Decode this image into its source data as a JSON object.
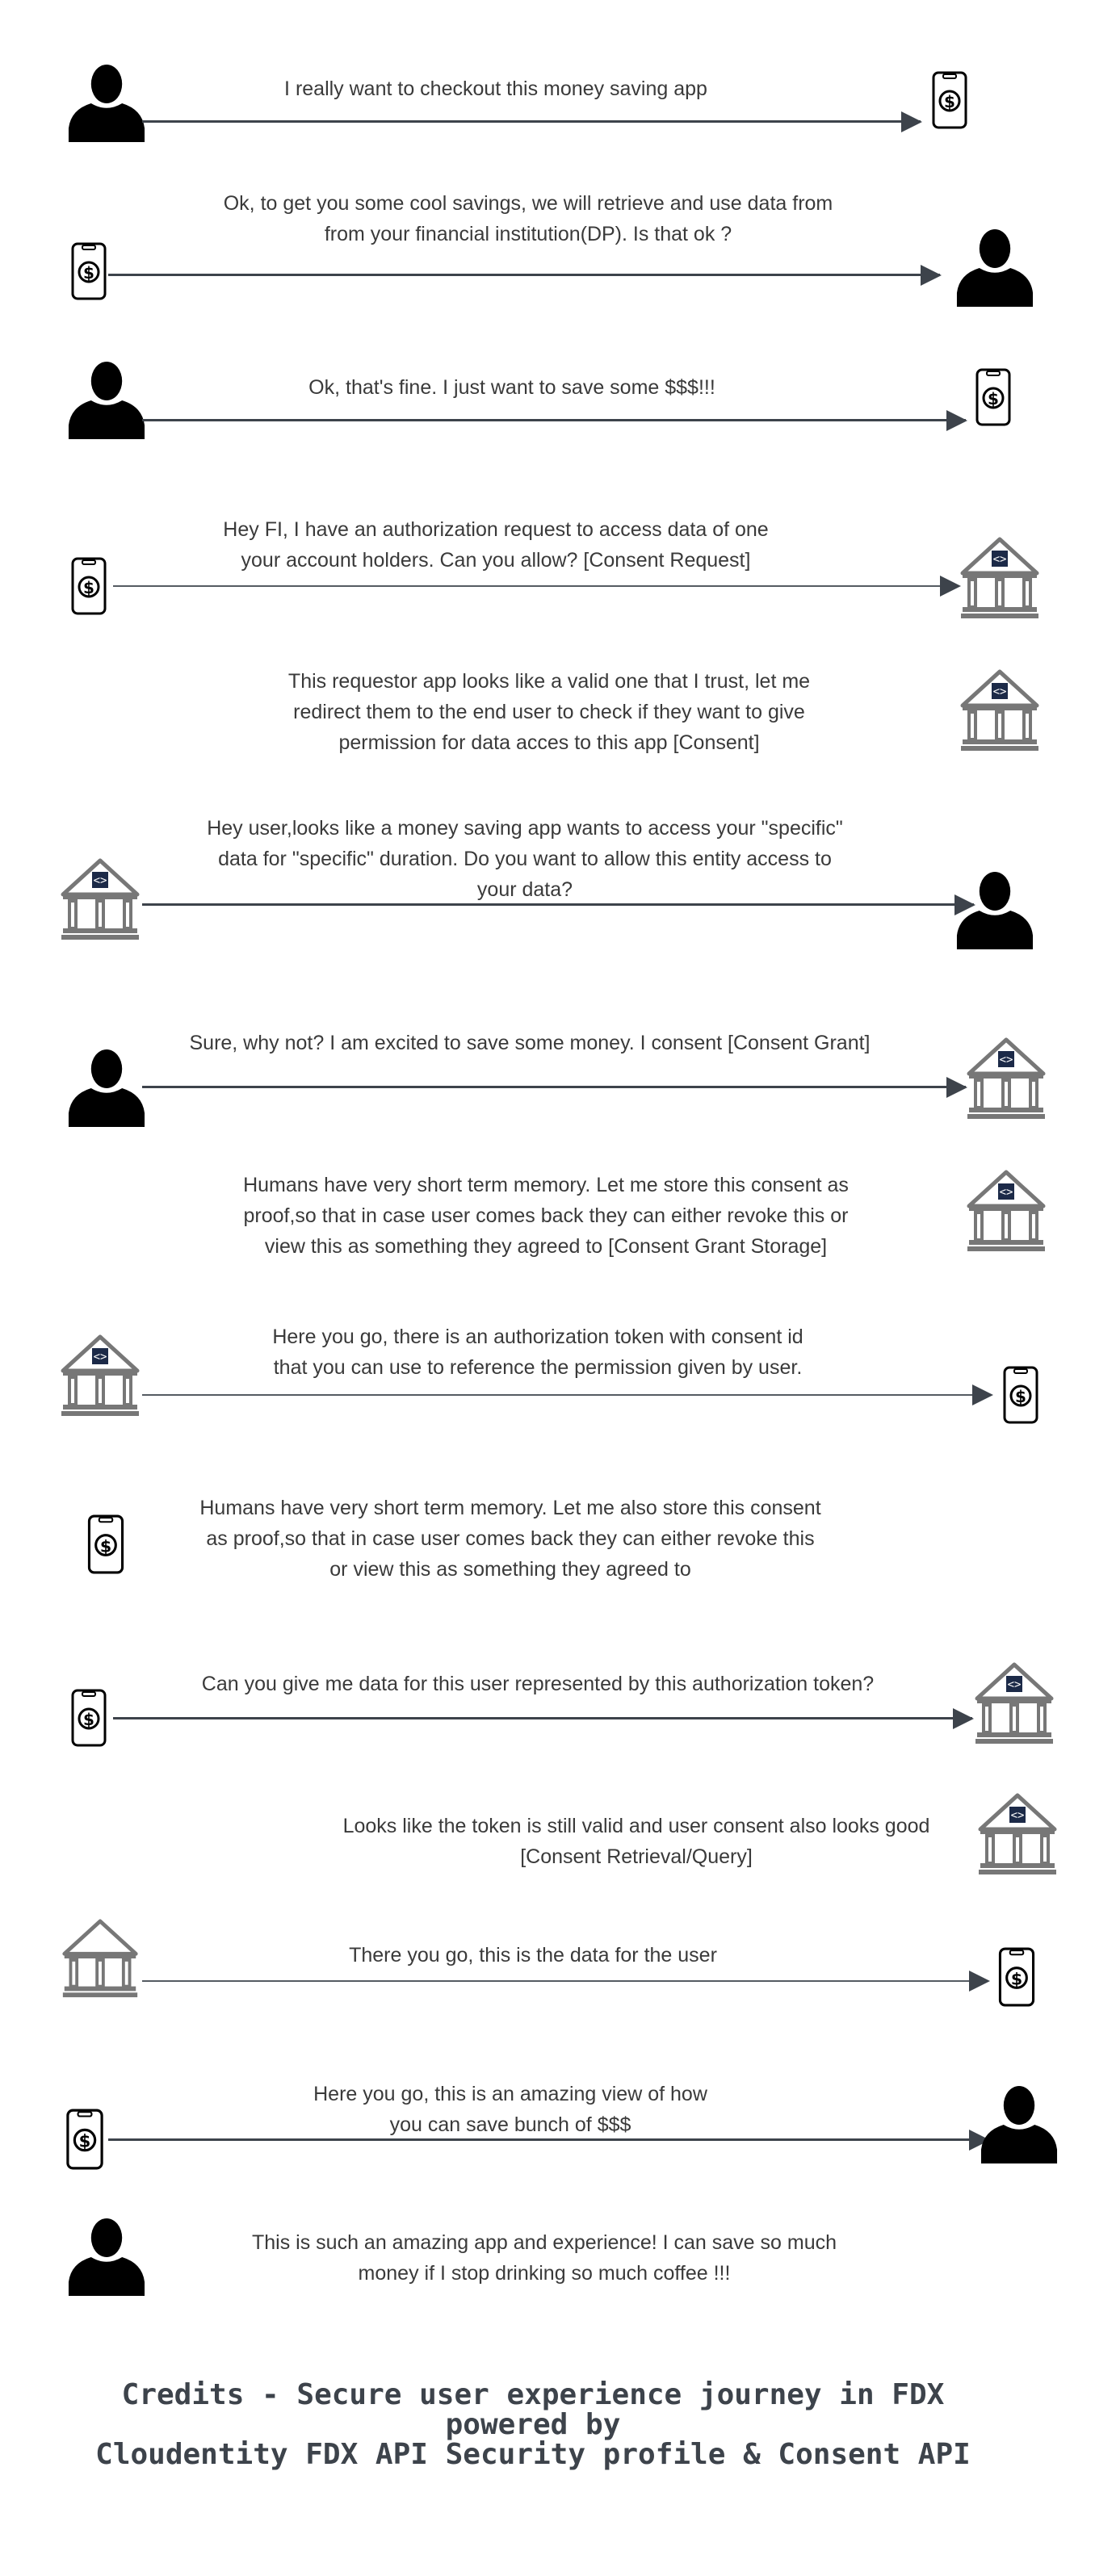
{
  "colors": {
    "arrow": "#3d434b",
    "text": "#3a3a3a",
    "bank": "#777777",
    "bank_logo": "#1c2a48",
    "user": "#000000"
  },
  "steps": [
    {
      "from": "user",
      "to": "app",
      "lines": [
        "I really want to checkout this money saving app"
      ]
    },
    {
      "from": "app",
      "to": "user",
      "lines": [
        "Ok, to get you some cool savings, we will retrieve and use data from",
        "from your financial institution(DP). Is that ok ?"
      ]
    },
    {
      "from": "user",
      "to": "app",
      "lines": [
        "Ok, that's fine. I just want to save some $$$!!!"
      ]
    },
    {
      "from": "app",
      "to": "bank",
      "lines": [
        "Hey FI, I have an authorization request to access data of one",
        "your account holders. Can you allow? [Consent Request]"
      ]
    },
    {
      "actor": "bank",
      "lines": [
        "This requestor app looks like a valid one that I trust, let me",
        "redirect them to the end user to check if they want to give",
        "permission for data acces to this app [Consent]"
      ]
    },
    {
      "from": "bank",
      "to": "user",
      "lines": [
        "Hey user,looks like a money saving app wants to access your \"specific\"",
        "data for \"specific\" duration. Do you want to allow this entity access to",
        "your data?"
      ]
    },
    {
      "from": "user",
      "to": "bank",
      "lines": [
        "Sure, why not? I am excited to save some money. I consent [Consent Grant]"
      ]
    },
    {
      "actor": "bank",
      "lines": [
        "Humans have very short term memory. Let me store this consent as",
        "proof,so that in case user comes back they can either revoke this or",
        "view this as something they agreed to [Consent Grant Storage]"
      ]
    },
    {
      "from": "bank",
      "to": "app",
      "lines": [
        "Here you go, there is an authorization token with consent id",
        "that you can use to reference the permission given by user."
      ]
    },
    {
      "actor": "app",
      "lines": [
        "Humans have very short term memory. Let me also store this consent",
        "as proof,so that in case user comes back they can either revoke this",
        "or view this as something they agreed to"
      ]
    },
    {
      "from": "app",
      "to": "bank",
      "lines": [
        "Can you give me data for this user represented by this authorization token?"
      ]
    },
    {
      "actor": "bank",
      "lines": [
        "Looks like the token is still valid and user consent also looks good",
        "[Consent Retrieval/Query]"
      ]
    },
    {
      "from": "bank",
      "to": "app",
      "lines": [
        "There you go, this is the data for the user"
      ]
    },
    {
      "from": "app",
      "to": "user",
      "lines": [
        "Here you go, this is an amazing view of how",
        "you can save bunch of $$$"
      ]
    },
    {
      "actor": "user",
      "lines": [
        "This is such an amazing app and experience! I can save so much",
        "money if I stop drinking so much coffee !!!"
      ]
    }
  ],
  "credits": {
    "line1": "Credits - Secure user experience journey in FDX",
    "line2": "powered by",
    "line3": "Cloudentity FDX API Security profile & Consent API"
  }
}
